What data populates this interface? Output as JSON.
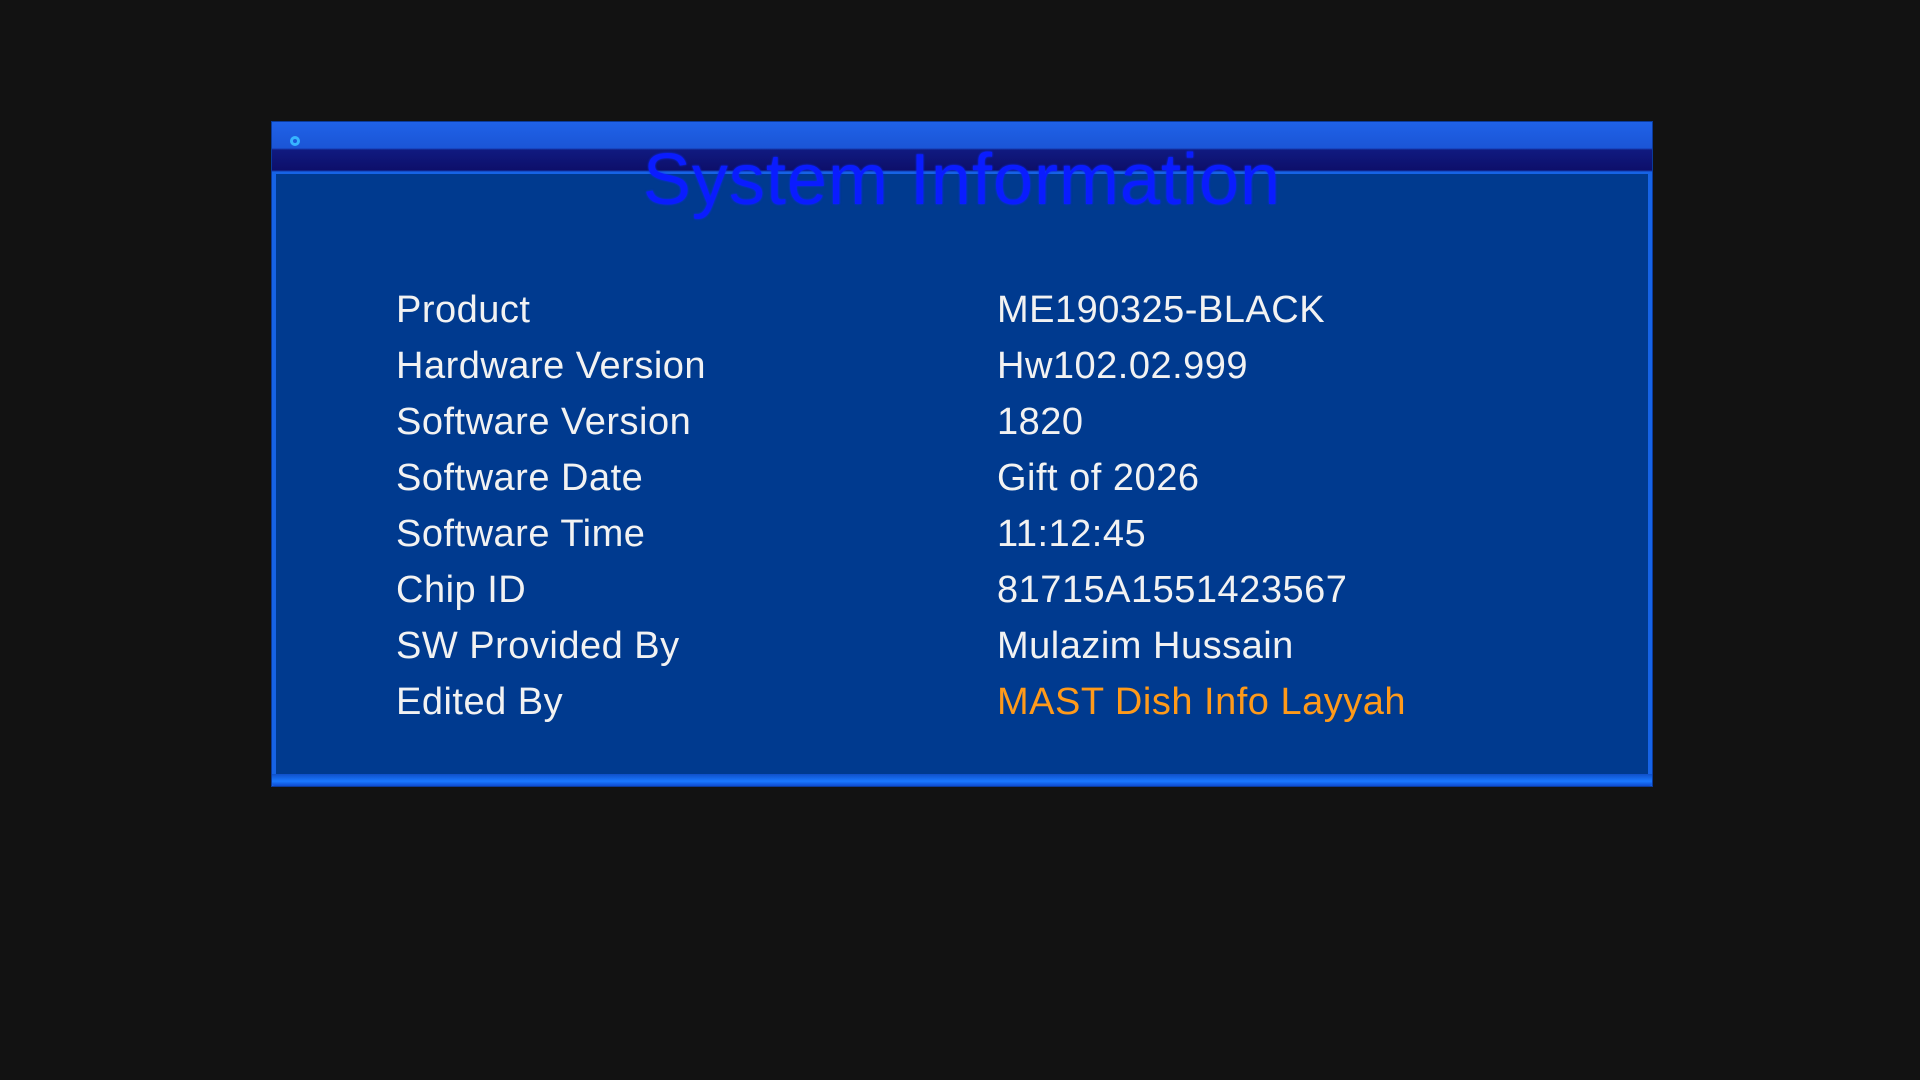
{
  "window": {
    "title": "System Information"
  },
  "info": [
    {
      "label": "Product",
      "value": "ME190325-BLACK"
    },
    {
      "label": "Hardware Version",
      "value": "Hw102.02.999"
    },
    {
      "label": "Software Version",
      "value": "1820"
    },
    {
      "label": "Software Date",
      "value": "Gift of 2026"
    },
    {
      "label": "Software Time",
      "value": "11:12:45"
    },
    {
      "label": "Chip ID",
      "value": "81715A1551423567"
    },
    {
      "label": "SW Provided By",
      "value": "Mulazim Hussain"
    },
    {
      "label": "Edited By",
      "value": "MAST Dish Info Layyah",
      "value_color": "#ff9a1a"
    }
  ],
  "colors": {
    "background": "#121212",
    "panel": "#003a8f",
    "accent": "#1663e6",
    "title_text": "#0a1cff",
    "text": "#f2f2f2",
    "highlight": "#ff9a1a"
  },
  "icons": {
    "title_marker": "circle-icon"
  }
}
